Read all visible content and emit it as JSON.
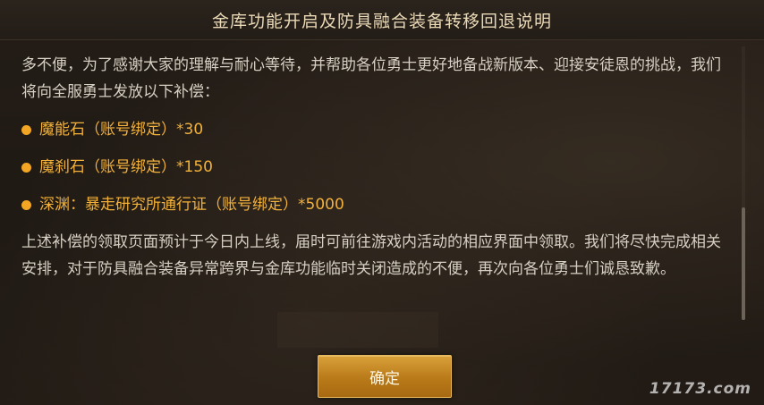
{
  "dialog": {
    "title": "金库功能开启及防具融合装备转移回退说明"
  },
  "content": {
    "faded_top_line": "",
    "paragraph_1": "多不便，为了感谢大家的理解与耐心等待，并帮助各位勇士更好地备战新版本、迎接安徒恩的挑战，我们将向全服勇士发放以下补偿：",
    "rewards": [
      {
        "label": "魔能石（账号绑定）*30"
      },
      {
        "label": "魔刹石（账号绑定）*150"
      },
      {
        "label": "深渊：暴走研究所通行证（账号绑定）*5000"
      }
    ],
    "paragraph_2": "上述补偿的领取页面预计于今日内上线，届时可前往游戏内活动的相应界面中领取。我们将尽快完成相关安排，对于防具融合装备异常跨界与金库功能临时关闭造成的不便，再次向各位勇士们诚恳致歉。"
  },
  "buttons": {
    "confirm_label": "确定"
  },
  "watermark": {
    "text": "17173.com"
  },
  "colors": {
    "accent": "#f2a623",
    "button": "#c48720",
    "title_text": "#ead9b6",
    "body_text": "#d6d0c4",
    "background": "#211b15"
  }
}
